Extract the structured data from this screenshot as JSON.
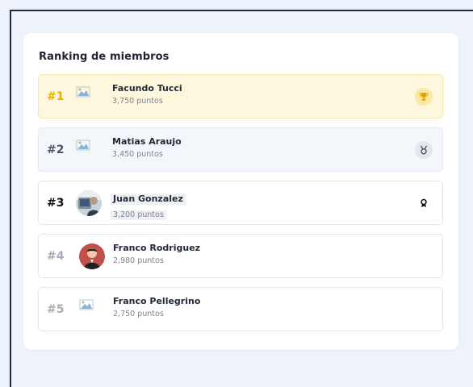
{
  "ranking": {
    "title": "Ranking de miembros",
    "members": [
      {
        "rank": "#1",
        "name": "Facundo Tucci",
        "points": "3,750 puntos",
        "avatar": "broken-image-icon",
        "badge": "trophy-icon"
      },
      {
        "rank": "#2",
        "name": "Matias Araujo",
        "points": "3,450 puntos",
        "avatar": "broken-image-icon",
        "badge": "medal-icon"
      },
      {
        "rank": "#3",
        "name": "Juan Gonzalez",
        "points": "3,200 puntos",
        "avatar": "avatar-photo",
        "badge": "award-icon"
      },
      {
        "rank": "#4",
        "name": "Franco Rodriguez",
        "points": "2,980 puntos",
        "avatar": "avatar-photo"
      },
      {
        "rank": "#5",
        "name": "Franco Pellegrino",
        "points": "2,750 puntos",
        "avatar": "broken-image-icon"
      }
    ]
  },
  "colors": {
    "gold_rank": "#e9b000",
    "gold_row_bg": "#fdf7dd",
    "silver_row_bg": "#f3f7fb",
    "muted_rank": "#a6abb5",
    "page_bg": "#eef3fb"
  }
}
